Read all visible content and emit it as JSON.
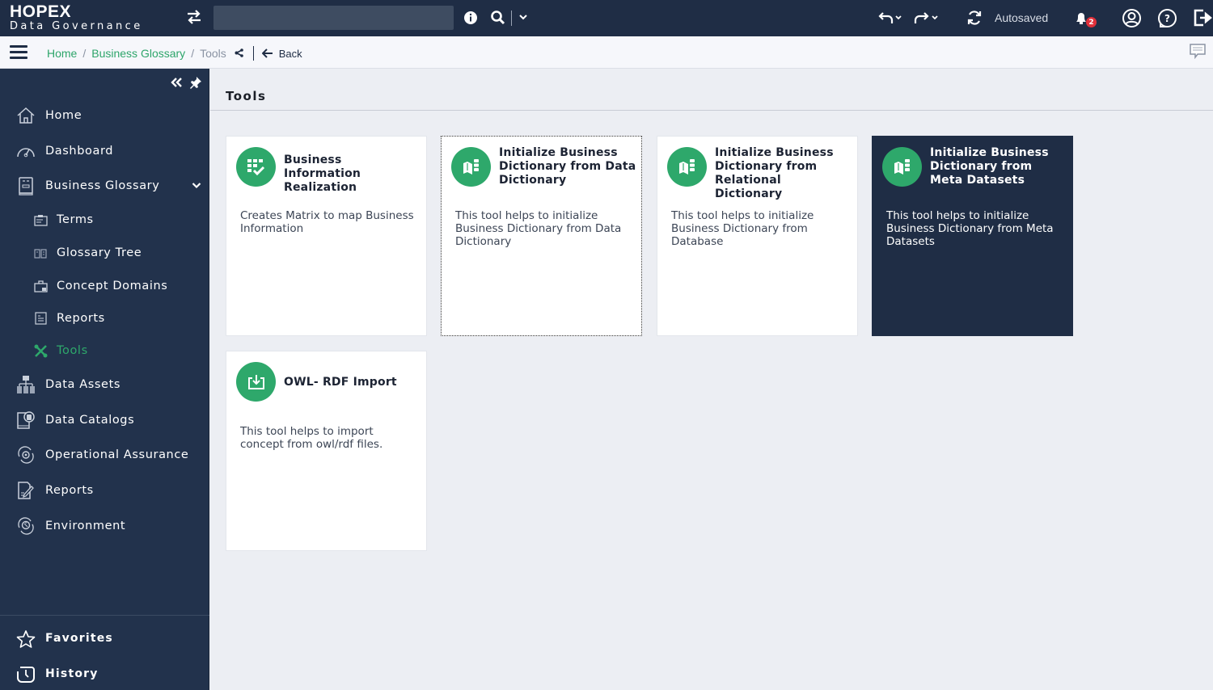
{
  "header": {
    "brand": "HOPEX",
    "subtitle": "Data Governance",
    "search_placeholder": "",
    "autosave_status": "Autosaved",
    "notification_count": "2",
    "icons": [
      "swap-icon",
      "info-icon",
      "search-icon",
      "chevron-down-icon",
      "undo-icon",
      "redo-icon",
      "sync-icon",
      "bell-icon",
      "user-icon",
      "help-icon",
      "logout-icon"
    ]
  },
  "breadcrumb": {
    "items": [
      "Home",
      "Business Glossary",
      "Tools"
    ],
    "separator": "/",
    "back_label": "Back"
  },
  "sidebar": {
    "items": [
      {
        "label": "Home",
        "icon": "home-icon"
      },
      {
        "label": "Dashboard",
        "icon": "dashboard-icon"
      },
      {
        "label": "Business Glossary",
        "icon": "glossary-icon",
        "expanded": true
      },
      {
        "label": "Terms",
        "icon": "terms-icon"
      },
      {
        "label": "Glossary Tree",
        "icon": "tree-icon"
      },
      {
        "label": "Concept Domains",
        "icon": "domains-icon"
      },
      {
        "label": "Reports",
        "icon": "report-icon"
      },
      {
        "label": "Tools",
        "icon": "tools-icon",
        "active": true
      },
      {
        "label": "Data Assets",
        "icon": "data-assets-icon"
      },
      {
        "label": "Data Catalogs",
        "icon": "catalog-icon"
      },
      {
        "label": "Operational Assurance",
        "icon": "assurance-icon"
      },
      {
        "label": "Reports",
        "icon": "reports-icon"
      },
      {
        "label": "Environment",
        "icon": "environment-icon"
      }
    ],
    "bottom": [
      {
        "label": "Favorites",
        "icon": "star-icon"
      },
      {
        "label": "History",
        "icon": "history-icon"
      }
    ]
  },
  "main": {
    "title": "Tools",
    "cards": [
      {
        "title": "Business Information Realization",
        "description": "Creates Matrix to map Business Information",
        "icon": "matrix-check-icon"
      },
      {
        "title": "Initialize Business Dictionary from Data Dictionary",
        "description": "This tool helps to initialize Business Dictionary from Data Dictionary",
        "icon": "dictionary-icon"
      },
      {
        "title": "Initialize Business Dictionary from Relational Dictionary",
        "description": "This tool helps to initialize Business Dictionary from Database",
        "icon": "dictionary-icon"
      },
      {
        "title": "Initialize Business Dictionary from Meta Datasets",
        "description": "This tool helps to initialize Business Dictionary from Meta Datasets",
        "icon": "dictionary-icon"
      },
      {
        "title": "OWL- RDF Import",
        "description": "This tool helps to import concept from owl/rdf files.",
        "icon": "import-icon"
      }
    ]
  },
  "colors": {
    "header_bg": "#1f2d45",
    "accent_green": "#2ea86b",
    "badge_red": "#e0303a",
    "content_bg": "#eceef3"
  }
}
